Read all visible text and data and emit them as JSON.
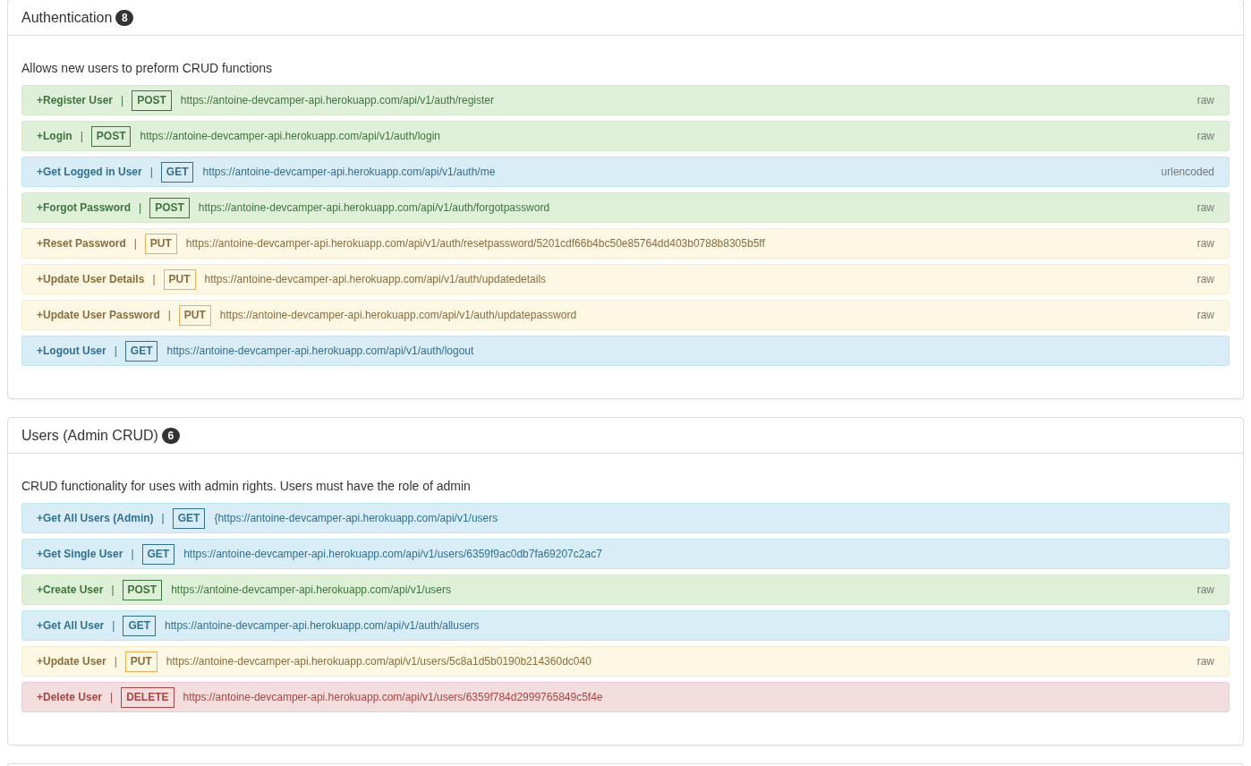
{
  "sections": [
    {
      "title": "Authentication",
      "count": "8",
      "description": "Allows new users to preform CRUD functions",
      "endpoints": [
        {
          "name": "+Register User",
          "separator": "|",
          "method": "POST",
          "kind": "post",
          "url": "https://antoine-devcamper-api.herokuapp.com/api/v1/auth/register",
          "body_type": "raw"
        },
        {
          "name": "+Login",
          "separator": "|",
          "method": "POST",
          "kind": "post",
          "url": "https://antoine-devcamper-api.herokuapp.com/api/v1/auth/login",
          "body_type": "raw"
        },
        {
          "name": "+Get Logged in User",
          "separator": "|",
          "method": "GET",
          "kind": "get",
          "url": "https://antoine-devcamper-api.herokuapp.com/api/v1/auth/me",
          "body_type": "urlencoded"
        },
        {
          "name": "+Forgot Password",
          "separator": "|",
          "method": "POST",
          "kind": "post",
          "url": "https://antoine-devcamper-api.herokuapp.com/api/v1/auth/forgotpassword",
          "body_type": "raw"
        },
        {
          "name": "+Reset Password",
          "separator": "|",
          "method": "PUT",
          "kind": "put",
          "url": "https://antoine-devcamper-api.herokuapp.com/api/v1/auth/resetpassword/5201cdf66b4bc50e85764dd403b0788b8305b5ff",
          "body_type": "raw"
        },
        {
          "name": "+Update User Details",
          "separator": "|",
          "method": "PUT",
          "kind": "put",
          "url": "https://antoine-devcamper-api.herokuapp.com/api/v1/auth/updatedetails",
          "body_type": "raw"
        },
        {
          "name": "+Update User Password",
          "separator": "|",
          "method": "PUT",
          "kind": "put",
          "url": "https://antoine-devcamper-api.herokuapp.com/api/v1/auth/updatepassword",
          "body_type": "raw"
        },
        {
          "name": "+Logout User",
          "separator": "|",
          "method": "GET",
          "kind": "get",
          "url": "https://antoine-devcamper-api.herokuapp.com/api/v1/auth/logout"
        }
      ]
    },
    {
      "title": "Users (Admin CRUD)",
      "count": "6",
      "description": "CRUD functionality for uses with admin rights. Users must have the role of admin",
      "endpoints": [
        {
          "name": "+Get All Users (Admin)",
          "separator": "|",
          "method": "GET",
          "kind": "get",
          "url": "{https://antoine-devcamper-api.herokuapp.com/api/v1/users"
        },
        {
          "name": "+Get Single User",
          "separator": "|",
          "method": "GET",
          "kind": "get",
          "url": "https://antoine-devcamper-api.herokuapp.com/api/v1/users/6359f9ac0db7fa69207c2ac7"
        },
        {
          "name": "+Create User",
          "separator": "|",
          "method": "POST",
          "kind": "post",
          "url": "https://antoine-devcamper-api.herokuapp.com/api/v1/users",
          "body_type": "raw"
        },
        {
          "name": "+Get All User",
          "separator": "|",
          "method": "GET",
          "kind": "get",
          "url": "https://antoine-devcamper-api.herokuapp.com/api/v1/auth/allusers"
        },
        {
          "name": "+Update User",
          "separator": "|",
          "method": "PUT",
          "kind": "put",
          "url": "https://antoine-devcamper-api.herokuapp.com/api/v1/users/5c8a1d5b0190b214360dc040",
          "body_type": "raw"
        },
        {
          "name": "+Delete User",
          "separator": "|",
          "method": "DELETE",
          "kind": "delete",
          "url": "https://antoine-devcamper-api.herokuapp.com/api/v1/users/6359f784d2999765849c5f4e"
        }
      ]
    }
  ]
}
